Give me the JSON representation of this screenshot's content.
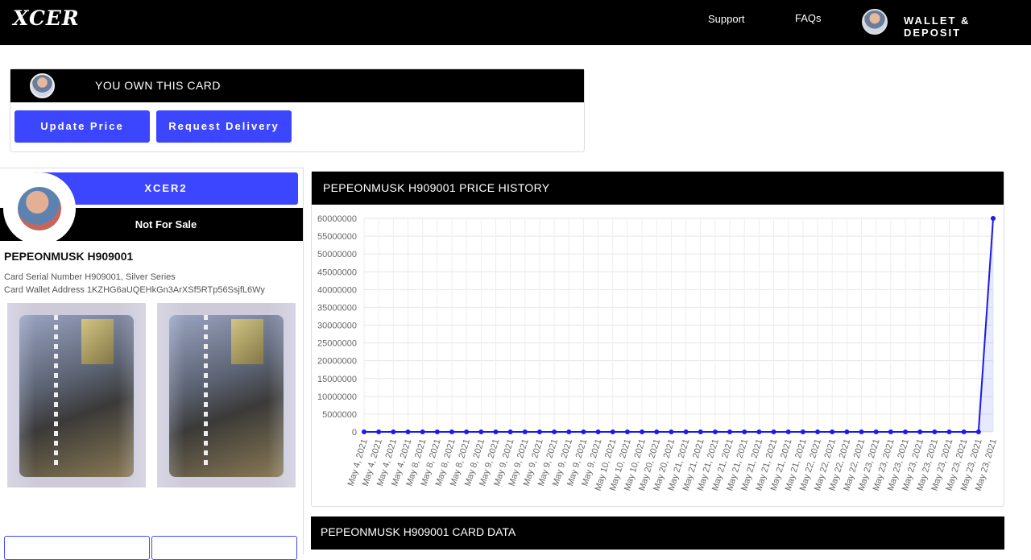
{
  "nav": {
    "logo": "XCER",
    "support": "Support",
    "faqs": "FAQs",
    "wallet": "WALLET & DEPOSIT"
  },
  "ownership": {
    "title": "YOU OWN THIS CARD",
    "update_price": "Update Price",
    "request_delivery": "Request Delivery"
  },
  "card": {
    "owner": "XCER2",
    "sale_status": "Not For Sale",
    "name": "PEPEONMUSK H909001",
    "serial": "Card Serial Number H909001, Silver Series",
    "wallet_address": "Card Wallet Address 1KZHG6aUQEHkGn3ArXSf5RTp56SsjfL6Wy"
  },
  "price_history": {
    "title": "PEPEONMUSK H909001 PRICE HISTORY"
  },
  "card_data": {
    "title": "PEPEONMUSK H909001 CARD DATA"
  },
  "colors": {
    "accent": "#3c46ff",
    "line": "#1a1aee",
    "header": "#000000"
  },
  "chart_data": {
    "type": "line",
    "ylim": [
      0,
      60000000
    ],
    "yticks": [
      0,
      5000000,
      10000000,
      15000000,
      20000000,
      25000000,
      30000000,
      35000000,
      40000000,
      45000000,
      50000000,
      55000000,
      60000000
    ],
    "grid": true,
    "x": [
      "May 4, 2021",
      "May 4, 2021",
      "May 4, 2021",
      "May 4, 2021",
      "May 8, 2021",
      "May 8, 2021",
      "May 8, 2021",
      "May 8, 2021",
      "May 8, 2021",
      "May 9, 2021",
      "May 9, 2021",
      "May 9, 2021",
      "May 9, 2021",
      "May 9, 2021",
      "May 9, 2021",
      "May 9, 2021",
      "May 9, 2021",
      "May 10, 2021",
      "May 10, 2021",
      "May 10, 2021",
      "May 20, 2021",
      "May 20, 2021",
      "May 21, 2021",
      "May 21, 2021",
      "May 21, 2021",
      "May 21, 2021",
      "May 21, 2021",
      "May 21, 2021",
      "May 21, 2021",
      "May 21, 2021",
      "May 21, 2021",
      "May 22, 2021",
      "May 22, 2021",
      "May 22, 2021",
      "May 22, 2021",
      "May 23, 2021",
      "May 23, 2021",
      "May 23, 2021",
      "May 23, 2021",
      "May 23, 2021",
      "May 23, 2021",
      "May 23, 2021",
      "May 23, 2021",
      "May 23, 2021"
    ],
    "series": [
      {
        "values": [
          0,
          0,
          0,
          0,
          0,
          0,
          0,
          0,
          0,
          0,
          0,
          0,
          0,
          0,
          0,
          0,
          0,
          0,
          0,
          0,
          0,
          0,
          0,
          0,
          0,
          0,
          0,
          0,
          0,
          0,
          0,
          0,
          0,
          0,
          0,
          0,
          0,
          0,
          0,
          0,
          0,
          0,
          0,
          60000000
        ]
      }
    ]
  }
}
